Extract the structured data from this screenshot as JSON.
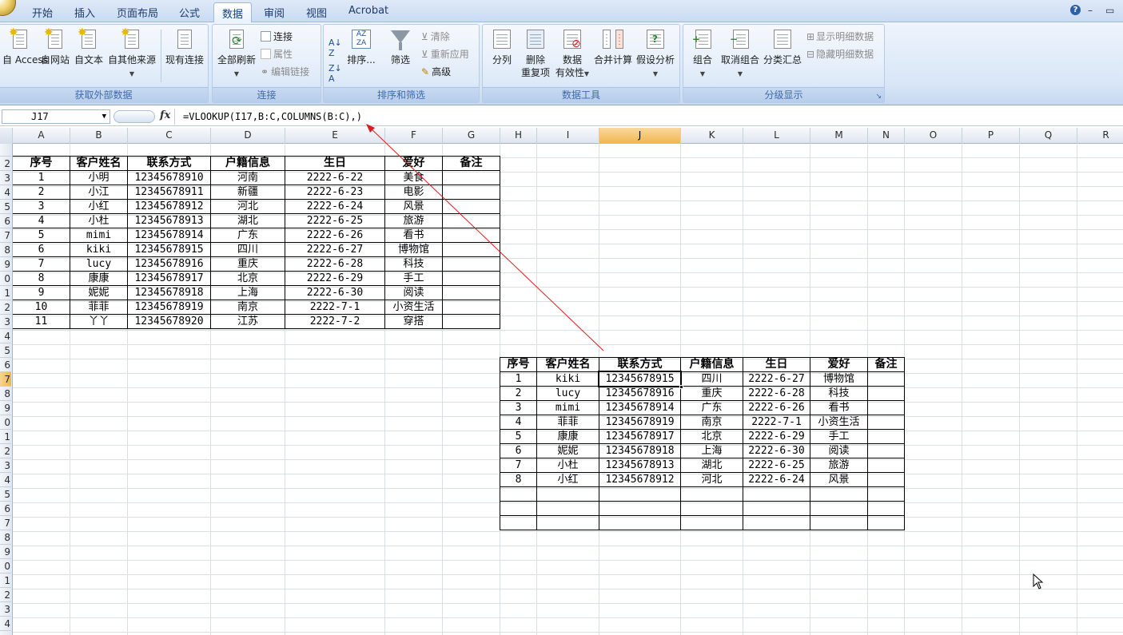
{
  "tabs": [
    "开始",
    "插入",
    "页面布局",
    "公式",
    "数据",
    "审阅",
    "视图",
    "Acrobat"
  ],
  "active_tab": "数据",
  "ribbon": {
    "get_external": {
      "title": "获取外部数据",
      "buttons": [
        "自 Access",
        "自网站",
        "自文本",
        "自其他来源",
        "现有连接"
      ]
    },
    "connections": {
      "title": "连接",
      "refresh": "全部刷新",
      "small": [
        "连接",
        "属性",
        "编辑链接"
      ]
    },
    "sort_filter": {
      "title": "排序和筛选",
      "sort": "排序...",
      "filter": "筛选",
      "small": [
        "清除",
        "重新应用",
        "高级"
      ]
    },
    "data_tools": {
      "title": "数据工具",
      "buttons": [
        "分列",
        "删除\n重复项",
        "数据\n有效性",
        "合并计算",
        "假设分析"
      ]
    },
    "outline": {
      "title": "分级显示",
      "buttons": [
        "组合",
        "取消组合",
        "分类汇总"
      ],
      "small": [
        "显示明细数据",
        "隐藏明细数据"
      ]
    }
  },
  "name_box": "J17",
  "formula": "=VLOOKUP(I17,B:C,COLUMNS(B:C),)",
  "columns": [
    "A",
    "B",
    "C",
    "D",
    "E",
    "F",
    "G",
    "H",
    "I",
    "J",
    "K",
    "L",
    "M",
    "N",
    "O",
    "P",
    "Q",
    "R"
  ],
  "selected_col": "J",
  "selected_row": "7",
  "row_labels": [
    "",
    "2",
    "3",
    "4",
    "5",
    "6",
    "7",
    "8",
    "9",
    "0",
    "1",
    "2",
    "3",
    "4",
    "5",
    "6",
    "7",
    "8",
    "9",
    "0",
    "1",
    "2",
    "3",
    "4",
    "5",
    "6",
    "7",
    "8",
    "9",
    "0",
    "1",
    "2",
    "3",
    "4"
  ],
  "table1": {
    "headers": [
      "序号",
      "客户姓名",
      "联系方式",
      "户籍信息",
      "生日",
      "爱好",
      "备注"
    ],
    "rows": [
      [
        "1",
        "小明",
        "12345678910",
        "河南",
        "2222-6-22",
        "美食",
        ""
      ],
      [
        "2",
        "小江",
        "12345678911",
        "新疆",
        "2222-6-23",
        "电影",
        ""
      ],
      [
        "3",
        "小红",
        "12345678912",
        "河北",
        "2222-6-24",
        "风景",
        ""
      ],
      [
        "4",
        "小杜",
        "12345678913",
        "湖北",
        "2222-6-25",
        "旅游",
        ""
      ],
      [
        "5",
        "mimi",
        "12345678914",
        "广东",
        "2222-6-26",
        "看书",
        ""
      ],
      [
        "6",
        "kiki",
        "12345678915",
        "四川",
        "2222-6-27",
        "博物馆",
        ""
      ],
      [
        "7",
        "lucy",
        "12345678916",
        "重庆",
        "2222-6-28",
        "科技",
        ""
      ],
      [
        "8",
        "康康",
        "12345678917",
        "北京",
        "2222-6-29",
        "手工",
        ""
      ],
      [
        "9",
        "妮妮",
        "12345678918",
        "上海",
        "2222-6-30",
        "阅读",
        ""
      ],
      [
        "10",
        "菲菲",
        "12345678919",
        "南京",
        "2222-7-1",
        "小资生活",
        ""
      ],
      [
        "11",
        "丫丫",
        "12345678920",
        "江苏",
        "2222-7-2",
        "穿搭",
        ""
      ]
    ]
  },
  "table2": {
    "headers": [
      "序号",
      "客户姓名",
      "联系方式",
      "户籍信息",
      "生日",
      "爱好",
      "备注"
    ],
    "rows": [
      [
        "1",
        "kiki",
        "12345678915",
        "四川",
        "2222-6-27",
        "博物馆",
        ""
      ],
      [
        "2",
        "lucy",
        "12345678916",
        "重庆",
        "2222-6-28",
        "科技",
        ""
      ],
      [
        "3",
        "mimi",
        "12345678914",
        "广东",
        "2222-6-26",
        "看书",
        ""
      ],
      [
        "4",
        "菲菲",
        "12345678919",
        "南京",
        "2222-7-1",
        "小资生活",
        ""
      ],
      [
        "5",
        "康康",
        "12345678917",
        "北京",
        "2222-6-29",
        "手工",
        ""
      ],
      [
        "6",
        "妮妮",
        "12345678918",
        "上海",
        "2222-6-30",
        "阅读",
        ""
      ],
      [
        "7",
        "小杜",
        "12345678913",
        "湖北",
        "2222-6-25",
        "旅游",
        ""
      ],
      [
        "8",
        "小红",
        "12345678912",
        "河北",
        "2222-6-24",
        "风景",
        ""
      ],
      [
        "",
        "",
        "",
        "",
        "",
        "",
        ""
      ],
      [
        "",
        "",
        "",
        "",
        "",
        "",
        ""
      ],
      [
        "",
        "",
        "",
        "",
        "",
        "",
        ""
      ]
    ]
  },
  "colors": {
    "accent": "#f1b54c",
    "arrow": "#e01b1b"
  }
}
